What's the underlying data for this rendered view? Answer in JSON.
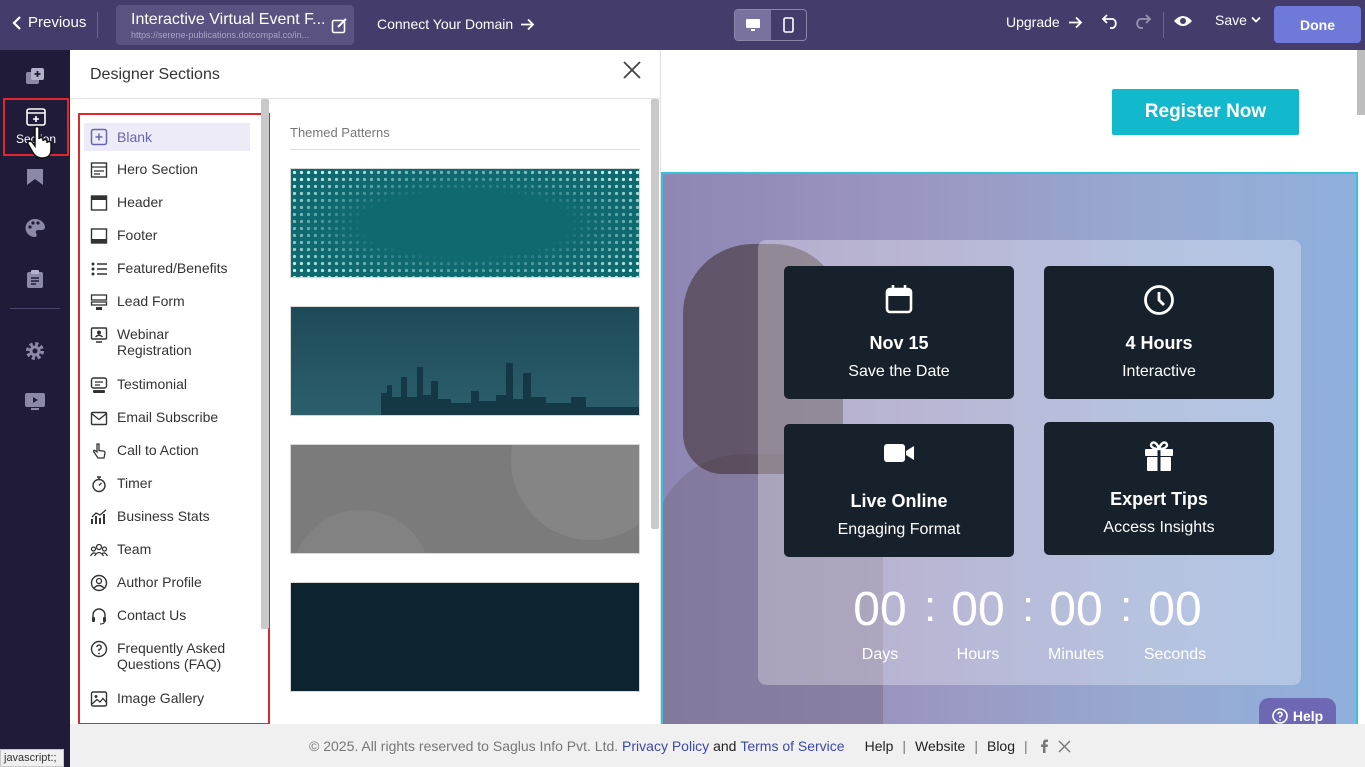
{
  "topbar": {
    "previous_label": "Previous",
    "page_title": "Interactive Virtual Event F...",
    "page_url": "https://serene-publications.dotcompal.co/in...",
    "connect_domain_label": "Connect Your Domain",
    "upgrade_label": "Upgrade",
    "save_label": "Save",
    "done_label": "Done"
  },
  "rail": {
    "section_label": "Section"
  },
  "status_text": "javascript:;",
  "panel": {
    "title": "Designer Sections",
    "themed_patterns_label": "Themed Patterns",
    "sections": [
      {
        "label": "Blank",
        "icon": "blank-icon"
      },
      {
        "label": "Hero Section",
        "icon": "hero-icon"
      },
      {
        "label": "Header",
        "icon": "header-icon"
      },
      {
        "label": "Footer",
        "icon": "footer-icon"
      },
      {
        "label": "Featured/Benefits",
        "icon": "list-icon"
      },
      {
        "label": "Lead Form",
        "icon": "form-icon"
      },
      {
        "label": "Webinar Registration",
        "icon": "webinar-icon"
      },
      {
        "label": "Testimonial",
        "icon": "testimonial-icon"
      },
      {
        "label": "Email Subscribe",
        "icon": "envelope-icon"
      },
      {
        "label": "Call to Action",
        "icon": "pointer-icon"
      },
      {
        "label": "Timer",
        "icon": "stopwatch-icon"
      },
      {
        "label": "Business Stats",
        "icon": "stats-icon"
      },
      {
        "label": "Team",
        "icon": "team-icon"
      },
      {
        "label": "Author Profile",
        "icon": "user-icon"
      },
      {
        "label": "Contact Us",
        "icon": "headset-icon"
      },
      {
        "label": "Frequently Asked Questions (FAQ)",
        "icon": "faq-icon"
      },
      {
        "label": "Image Gallery",
        "icon": "image-icon"
      }
    ]
  },
  "canvas": {
    "register_label": "Register Now",
    "tiles": [
      {
        "title": "Nov 15",
        "subtitle": "Save the Date",
        "icon": "calendar-icon"
      },
      {
        "title": "4 Hours",
        "subtitle": "Interactive",
        "icon": "clock-icon"
      },
      {
        "title": "Live Online",
        "subtitle": "Engaging Format",
        "icon": "video-camera-icon"
      },
      {
        "title": "Expert Tips",
        "subtitle": "Access Insights",
        "icon": "gift-icon"
      }
    ],
    "countdown": {
      "days": "00",
      "hours": "00",
      "minutes": "00",
      "seconds": "00",
      "days_label": "Days",
      "hours_label": "Hours",
      "minutes_label": "Minutes",
      "seconds_label": "Seconds"
    }
  },
  "help_label": "Help",
  "footer": {
    "copyright": "©  2025. All rights reserved to Saglus Info Pvt. Ltd.",
    "privacy": "Privacy Policy",
    "and": "and",
    "terms": "Terms of Service",
    "help": "Help",
    "website": "Website",
    "blog": "Blog"
  },
  "colors": {
    "topbar": "#443c6a",
    "rail": "#1f1b38",
    "accent": "#12b8cc",
    "done": "#6f7ad8",
    "highlight_border": "#e0262f"
  }
}
